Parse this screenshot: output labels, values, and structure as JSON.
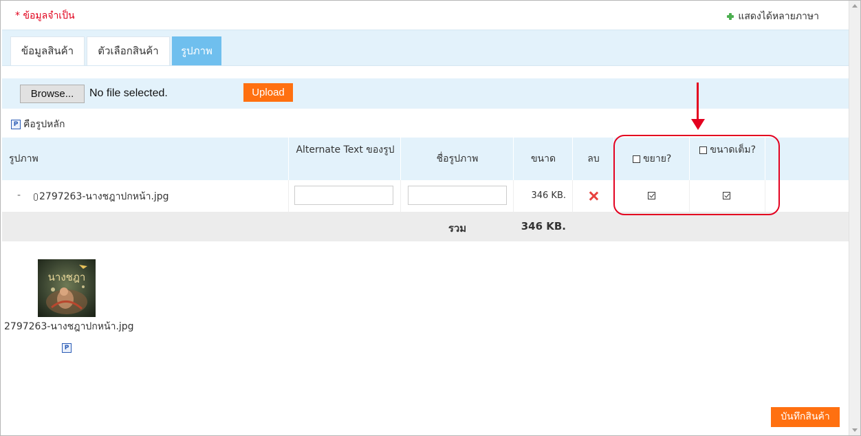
{
  "header": {
    "required_note": "* ข้อมูลจำเป็น",
    "multi_language": "แสดงได้หลายภาษา"
  },
  "tabs": [
    {
      "label": "ข้อมูลสินค้า",
      "active": false
    },
    {
      "label": "ตัวเลือกสินค้า",
      "active": false
    },
    {
      "label": "รูปภาพ",
      "active": true
    }
  ],
  "upload": {
    "browse_label": "Browse...",
    "file_status": "No file selected.",
    "upload_label": "Upload"
  },
  "main_image_note": {
    "icon_letter": "P",
    "text": "คือรูปหลัก"
  },
  "table": {
    "headers": {
      "image": "รูปภาพ",
      "alt_text": "Alternate Text ของรูป",
      "image_name": "ชื่อรูปภาพ",
      "size": "ขนาด",
      "delete": "ลบ",
      "zoom": "ขยาย?",
      "full_size": "ขนาดเต็ม?"
    },
    "rows": [
      {
        "dash": "-",
        "filename": "2797263-นางชฎาปกหน้า.jpg",
        "alt_text": "",
        "image_name": "",
        "size": "346 KB.",
        "zoom_checked": true,
        "full_size_checked": true
      }
    ],
    "total_label": "รวม",
    "total_size": "346 KB."
  },
  "thumbnail": {
    "caption": "2797263-นางชฎาปกหน้า.jpg",
    "main_badge": "P",
    "cover_text": "นางชฎา"
  },
  "footer": {
    "save_label": "บันทึกสินค้า"
  },
  "colors": {
    "accent_orange": "#ff7010",
    "tab_active": "#6fbfee",
    "light_blue_bg": "#e3f2fb",
    "annotation_red": "#e3001f",
    "required_red": "#e0001b"
  }
}
